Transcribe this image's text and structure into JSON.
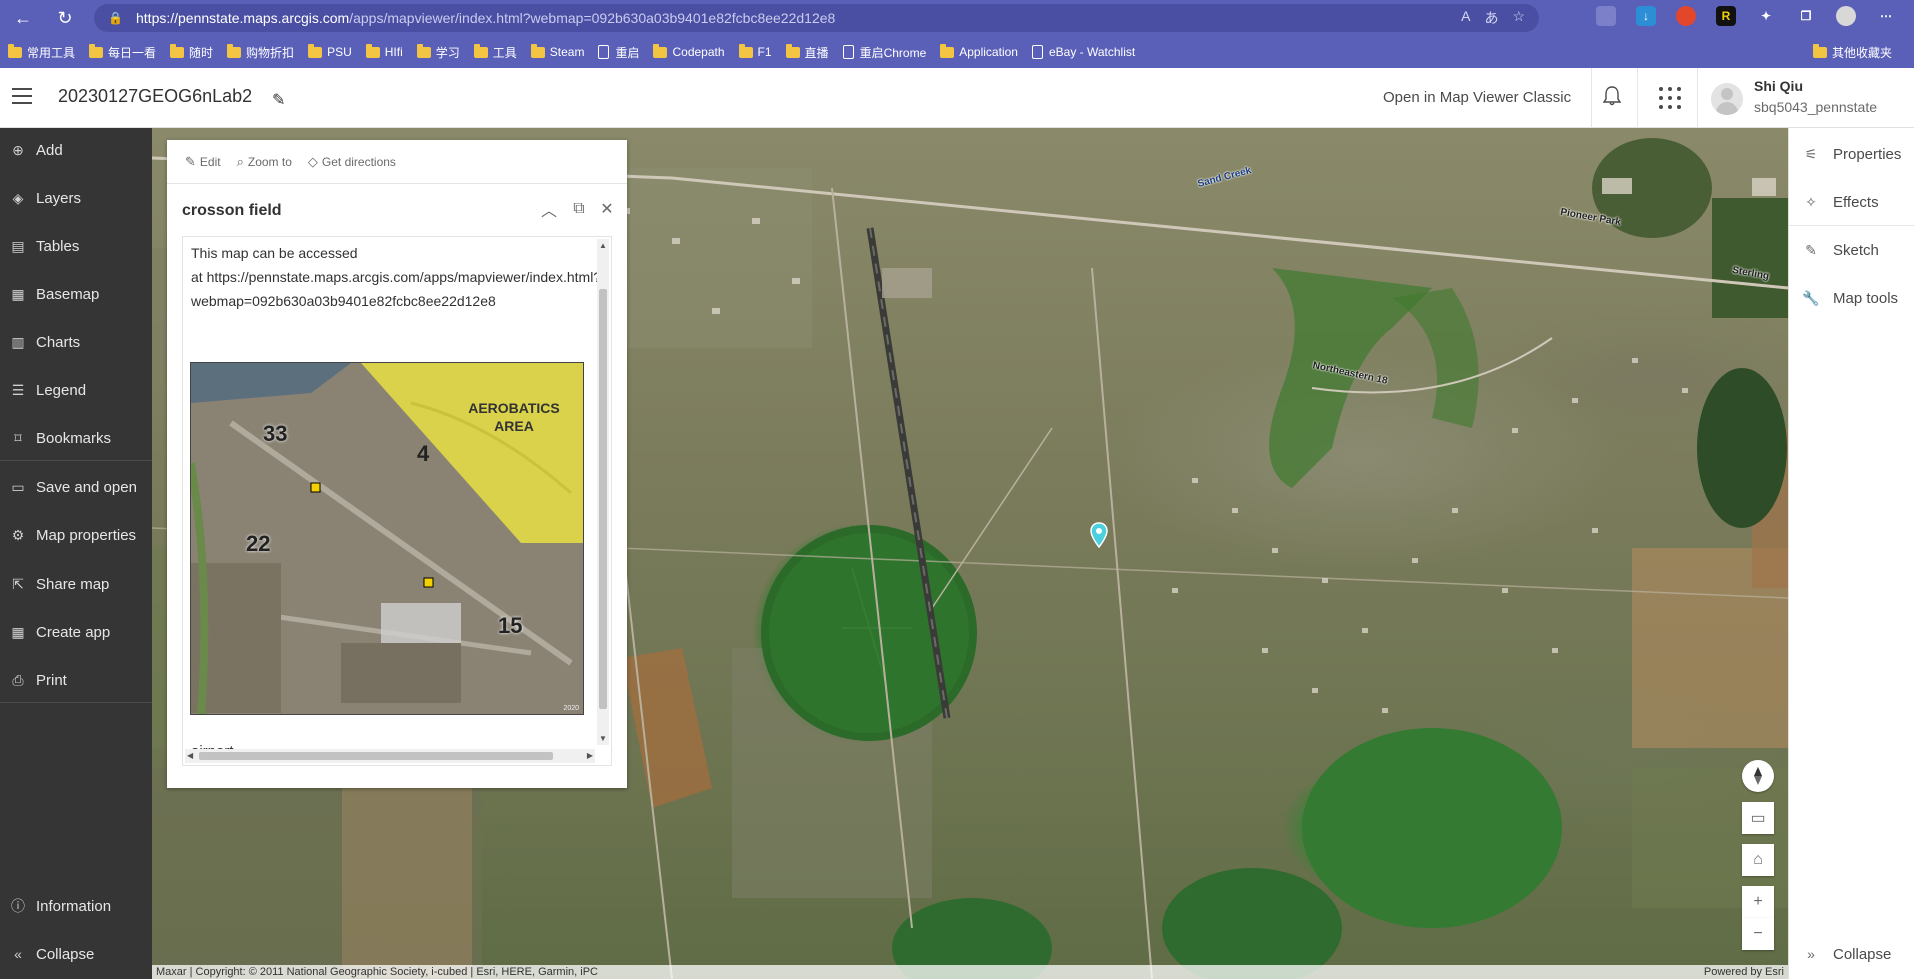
{
  "browser": {
    "url_host": "https://pennstate.maps.arcgis.com",
    "url_path": "/apps/mapviewer/index.html?webmap=092b630a03b9401e82fcbc8ee22d12e8",
    "bookmarks": [
      {
        "label": "常用工具",
        "type": "folder"
      },
      {
        "label": "每日一看",
        "type": "folder"
      },
      {
        "label": "随时",
        "type": "folder"
      },
      {
        "label": "购物折扣",
        "type": "folder"
      },
      {
        "label": "PSU",
        "type": "folder"
      },
      {
        "label": "HIfi",
        "type": "folder"
      },
      {
        "label": "学习",
        "type": "folder"
      },
      {
        "label": "工具",
        "type": "folder"
      },
      {
        "label": "Steam",
        "type": "folder"
      },
      {
        "label": "重启",
        "type": "page"
      },
      {
        "label": "Codepath",
        "type": "folder"
      },
      {
        "label": "F1",
        "type": "folder"
      },
      {
        "label": "直播",
        "type": "folder"
      },
      {
        "label": "重启Chrome",
        "type": "page"
      },
      {
        "label": "Application",
        "type": "folder"
      },
      {
        "label": "eBay - Watchlist",
        "type": "page"
      }
    ],
    "other_bookmarks": "其他收藏夹"
  },
  "header": {
    "map_title": "20230127GEOG6nLab2",
    "open_classic": "Open in Map Viewer Classic",
    "user_name": "Shi Qiu",
    "user_handle": "sbq5043_pennstate"
  },
  "left_panel": {
    "items": [
      {
        "label": "Add",
        "icon": "plus-circle-icon"
      },
      {
        "label": "Layers",
        "icon": "layers-icon"
      },
      {
        "label": "Tables",
        "icon": "table-icon"
      },
      {
        "label": "Basemap",
        "icon": "basemap-icon"
      },
      {
        "label": "Charts",
        "icon": "chart-icon"
      },
      {
        "label": "Legend",
        "icon": "legend-icon"
      },
      {
        "label": "Bookmarks",
        "icon": "bookmark-icon"
      },
      {
        "label": "Save and open",
        "icon": "folder-icon"
      },
      {
        "label": "Map properties",
        "icon": "gear-icon"
      },
      {
        "label": "Share map",
        "icon": "share-icon"
      },
      {
        "label": "Create app",
        "icon": "apps-icon"
      },
      {
        "label": "Print",
        "icon": "print-icon"
      }
    ],
    "information": "Information",
    "collapse": "Collapse"
  },
  "right_panel": {
    "items": [
      {
        "label": "Properties",
        "icon": "sliders-icon"
      },
      {
        "label": "Effects",
        "icon": "sparkle-icon"
      },
      {
        "label": "Sketch",
        "icon": "pen-icon"
      },
      {
        "label": "Map tools",
        "icon": "wrench-icon"
      }
    ],
    "collapse": "Collapse"
  },
  "popup": {
    "actions": {
      "edit": "Edit",
      "zoom_to": "Zoom to",
      "directions": "Get directions"
    },
    "title": "crosson field",
    "line1": "This map can be accessed",
    "line2": "at https://pennstate.maps.arcgis.com/apps/mapviewer/index.html?",
    "line3": "webmap=092b630a03b9401e82fcbc8ee22d12e8",
    "image_labels": {
      "runway_33": "33",
      "runway_4": "4",
      "runway_22": "22",
      "runway_15": "15",
      "aerobatics": "AEROBATICS AREA",
      "year": "2020"
    },
    "caption": "airport"
  },
  "map": {
    "labels": {
      "sand_creek": "Sand Creek",
      "pioneer_park": "Pioneer Park",
      "northeastern_18": "Northeastern 18",
      "sterling": "Sterling"
    },
    "attribution": "Maxar | Copyright: © 2011 National Geographic Society, i-cubed | Esri, HERE, Garmin, iPC",
    "powered_by": "Powered by Esri"
  }
}
